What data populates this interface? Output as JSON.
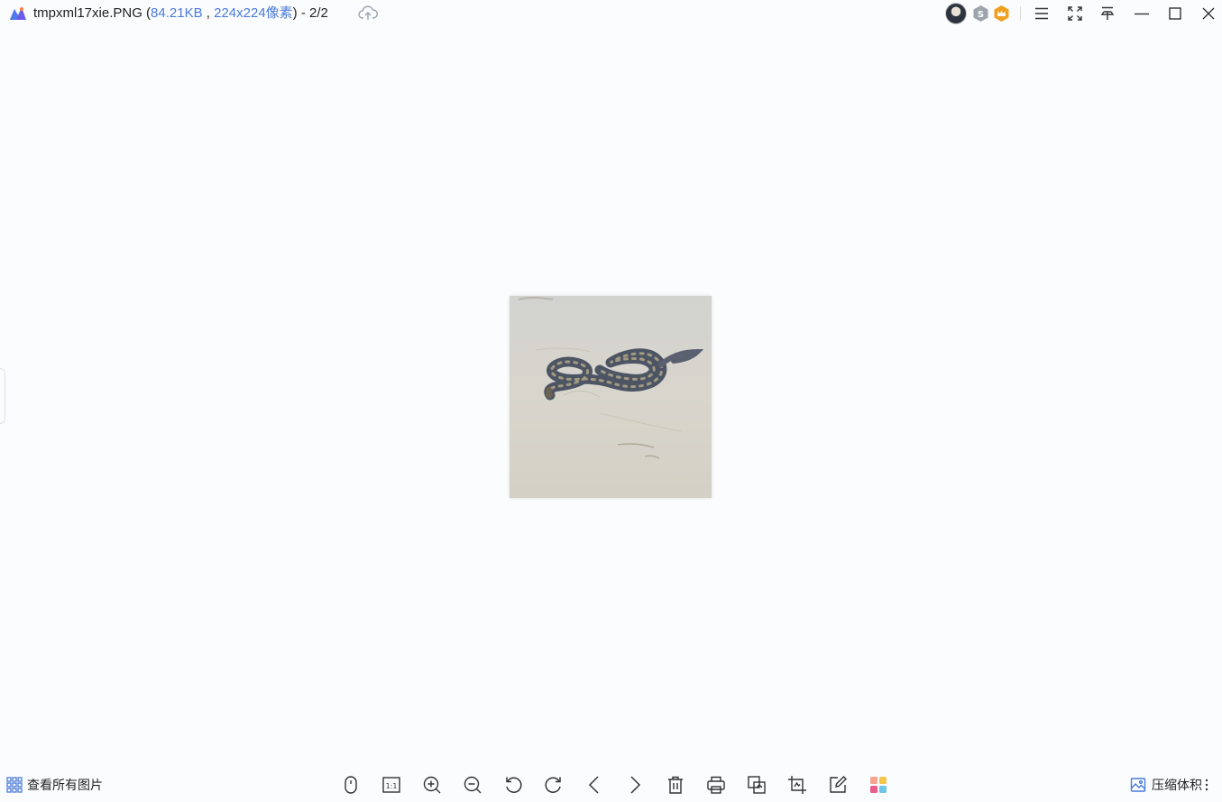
{
  "titlebar": {
    "filename": "tmpxml17xie.PNG",
    "open_paren": " (",
    "filesize": "84.21KB",
    "separator": " , ",
    "dimensions": "224x224像素",
    "close_paren_counter": ") - 2/2",
    "icons": [
      "app-logo-icon",
      "cloud-upload-icon",
      "user-avatar",
      "s-badge-icon",
      "vip-crown-icon",
      "menu-icon",
      "fullscreen-icon",
      "pin-icon",
      "minimize-icon",
      "maximize-icon",
      "close-icon"
    ]
  },
  "toolbar": {
    "view_all_label": "查看所有图片",
    "compress_label": "压缩体积",
    "tools": [
      "mouse-mode-icon",
      "actual-size-icon",
      "zoom-in-icon",
      "zoom-out-icon",
      "rotate-left-icon",
      "rotate-right-icon",
      "previous-icon",
      "next-icon",
      "delete-icon",
      "print-icon",
      "convert-icon",
      "crop-icon",
      "edit-icon",
      "apps-icon"
    ],
    "actual_size_text": "1:1"
  },
  "colors": {
    "background": "#fbfcfe",
    "accent": "#4a7bd8",
    "vip": "#f0a020"
  }
}
